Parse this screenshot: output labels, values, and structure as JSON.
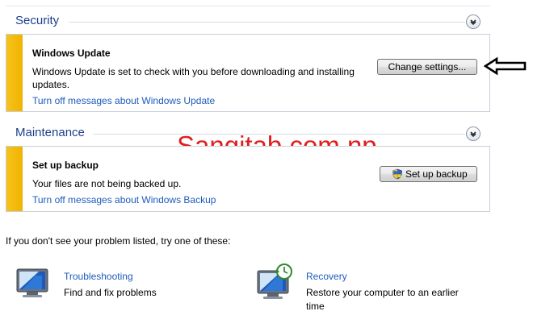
{
  "security": {
    "title": "Security",
    "card": {
      "title": "Windows Update",
      "text": "Windows Update is set to check with you before downloading and installing updates.",
      "link": "Turn off messages about Windows Update",
      "button": "Change settings..."
    }
  },
  "maintenance": {
    "title": "Maintenance",
    "card": {
      "title": "Set up backup",
      "text": "Your files are not being backed up.",
      "link": "Turn off messages about Windows Backup",
      "button": "Set up backup"
    }
  },
  "watermark": "Sangitab.com.np",
  "footer": {
    "prompt": "If you don't see your problem listed, try one of these:",
    "actions": [
      {
        "title": "Troubleshooting",
        "desc": "Find and fix problems",
        "icon": "troubleshooting-icon"
      },
      {
        "title": "Recovery",
        "desc": "Restore your computer to an earlier time",
        "icon": "recovery-icon"
      }
    ]
  },
  "colors": {
    "accent_link": "#1e5bbd",
    "section_title": "#1e3f8a",
    "warning_stripe": "#f0b400",
    "watermark": "#e01e1e"
  }
}
